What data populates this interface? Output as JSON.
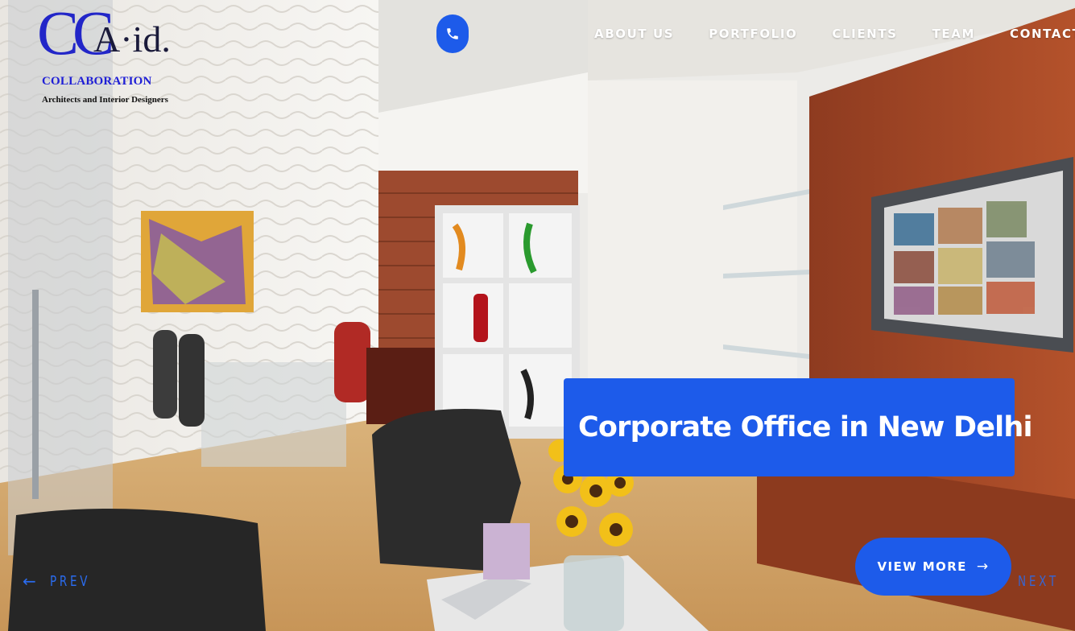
{
  "logo": {
    "mark": "CC",
    "name": "A·id.",
    "subtitle": "COLLABORATION",
    "tagline": "Architects and Interior Designers"
  },
  "header": {
    "phone_icon": "phone-icon",
    "nav": [
      "ABOUT US",
      "PORTFOLIO",
      "CLIENTS",
      "TEAM",
      "CONTACT"
    ]
  },
  "slide": {
    "caption": "Corporate Office in New Delhi",
    "view_more": "VIEW MORE",
    "view_more_arrow": "→"
  },
  "pager": {
    "prev_arrow": "←",
    "prev": "PREV",
    "next": "NEXT",
    "next_arrow": "→"
  },
  "colors": {
    "accent": "#1d5bea",
    "logo_blue": "#1e1ed6"
  }
}
